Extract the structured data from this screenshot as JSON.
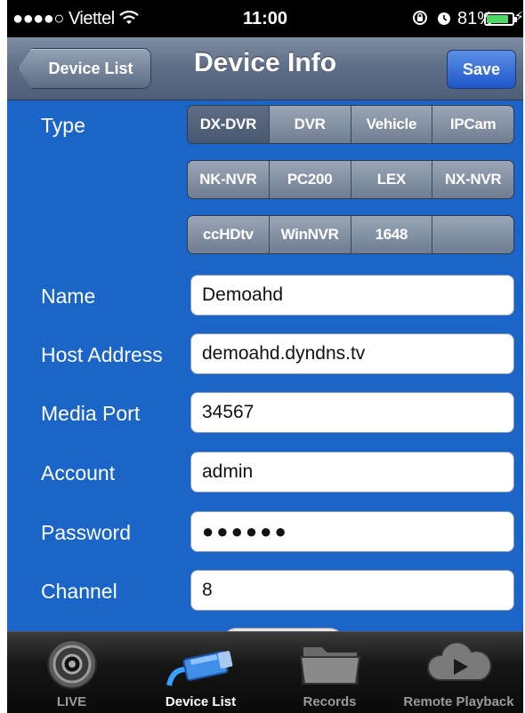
{
  "status_bar": {
    "carrier": "●●●●○ Viettel",
    "time": "11:00",
    "battery": "81%",
    "battery_level": 0.81
  },
  "nav": {
    "back_label": "Device List",
    "title": "Device Info",
    "save_label": "Save"
  },
  "form": {
    "type_label": "Type",
    "type_options": [
      [
        "DX-DVR",
        "DVR",
        "Vehicle",
        "IPCam"
      ],
      [
        "NK-NVR",
        "PC200",
        "LEX",
        "NX-NVR"
      ],
      [
        "ccHDtv",
        "WinNVR",
        "1648",
        ""
      ]
    ],
    "selected_type": "DX-DVR",
    "name_label": "Name",
    "name_value": "Demoahd",
    "host_label": "Host Address",
    "host_value": "demoahd.dyndns.tv",
    "port_label": "Media Port",
    "port_value": "34567",
    "account_label": "Account",
    "account_value": "admin",
    "password_label": "Password",
    "password_value": "●●●●●●",
    "channel_label": "Channel",
    "channel_value": "8"
  },
  "tabs": [
    {
      "label": "LIVE",
      "icon": "camera-lens-icon"
    },
    {
      "label": "Device List",
      "icon": "cctv-camera-icon"
    },
    {
      "label": "Records",
      "icon": "folder-icon"
    },
    {
      "label": "Remote Playback",
      "icon": "cloud-play-icon"
    }
  ],
  "active_tab": "Device List"
}
